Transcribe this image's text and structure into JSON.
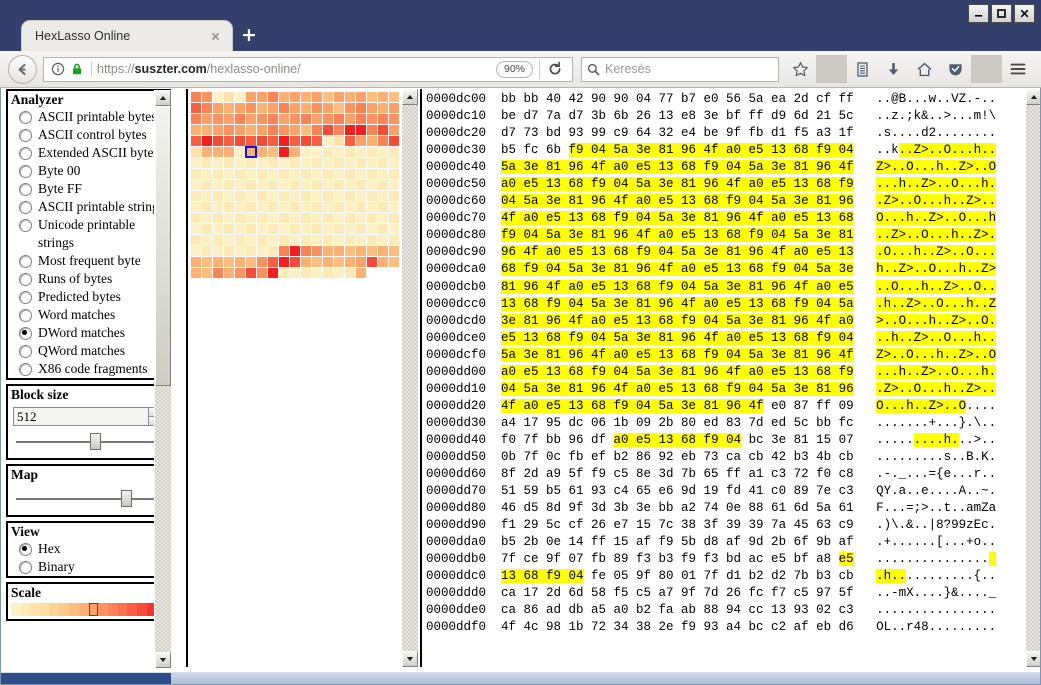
{
  "window": {
    "controls": [
      {
        "name": "minimize",
        "label": "–"
      },
      {
        "name": "maximize",
        "label": "□"
      },
      {
        "name": "close",
        "label": "✕"
      }
    ]
  },
  "browser": {
    "tab": {
      "title": "HexLasso Online",
      "close_label": "✕"
    },
    "new_tab_label": "+",
    "back_label": "←",
    "url": {
      "scheme": "https://",
      "host": "suszter.com",
      "path": "/hexlasso-online/",
      "full": "https://suszter.com/hexlasso-online/"
    },
    "zoom_level": "90%",
    "reload_label": "↻",
    "search_placeholder": "Keresés",
    "icons": {
      "info": "info-icon",
      "lock": "lock-icon",
      "search": "search-icon",
      "bookmark": "star-icon",
      "library": "library-icon",
      "downloads": "download-icon",
      "home": "home-icon",
      "shield": "shield-icon",
      "menu": "hamburger-menu-icon"
    }
  },
  "sidebar": {
    "analyzer": {
      "title": "Analyzer",
      "selected": "DWord matches",
      "options": [
        "ASCII printable bytes",
        "ASCII control bytes",
        "Extended ASCII bytes",
        "Byte 00",
        "Byte FF",
        "ASCII printable strings",
        "Unicode printable strings",
        "Most frequent byte",
        "Runs of bytes",
        "Predicted bytes",
        "Word matches",
        "DWord matches",
        "QWord matches",
        "X86 code fragments"
      ]
    },
    "block_size": {
      "title": "Block size",
      "value": "512",
      "slider_percent": 55
    },
    "map": {
      "title": "Map",
      "slider_percent": 78
    },
    "view": {
      "title": "View",
      "selected": "Hex",
      "options": [
        "Hex",
        "Binary"
      ]
    },
    "scale": {
      "title": "Scale",
      "selected_index": 8,
      "colors": [
        "#fdf0c4",
        "#fdeab6",
        "#fde3ab",
        "#fddca0",
        "#fdd395",
        "#fdc98a",
        "#fcbd7e",
        "#fcb074",
        "#fca269",
        "#fb9260",
        "#fb8257",
        "#fa704e",
        "#f95e43",
        "#f84a38",
        "#f6342c",
        "#f41e20"
      ]
    }
  },
  "heatmap": {
    "columns": 19,
    "selected_index": 100,
    "cells": [
      "#fb8257",
      "#fb9260",
      "#fdf0c4",
      "#fde3ab",
      "#fdf0c4",
      "#fca269",
      "#fca269",
      "#fb8257",
      "#fcb074",
      "#fca269",
      "#fcb074",
      "#fca269",
      "#fcbd7e",
      "#fca269",
      "#fcb074",
      "#fca269",
      "#fcbd7e",
      "#fcb074",
      "#fcbd7e",
      "#f95e43",
      "#fb8257",
      "#fca269",
      "#fcb074",
      "#fca269",
      "#fb9260",
      "#fcb074",
      "#fca269",
      "#fb8257",
      "#fca269",
      "#fcb074",
      "#fb9260",
      "#fca269",
      "#fcbd7e",
      "#fb9260",
      "#fb8257",
      "#fca269",
      "#fcb074",
      "#fca269",
      "#fb8257",
      "#fca269",
      "#fb9260",
      "#fca269",
      "#fb8257",
      "#fca269",
      "#fb9260",
      "#fb8257",
      "#fca269",
      "#fb9260",
      "#fb8257",
      "#fca269",
      "#fb9260",
      "#fb8257",
      "#fca269",
      "#fb8257",
      "#fb9260",
      "#fb8257",
      "#fb9260",
      "#fcb074",
      "#fcb074",
      "#fca269",
      "#fb9260",
      "#fca269",
      "#fcb074",
      "#fca269",
      "#fb8257",
      "#fb9260",
      "#fca269",
      "#fcbd7e",
      "#fb8257",
      "#f84a38",
      "#fb8257",
      "#f41e20",
      "#f41e20",
      "#fb8257",
      "#f84a38",
      "#fca269",
      "#f95e43",
      "#f41e20",
      "#f84a38",
      "#f95e43",
      "#f84a38",
      "#f95e43",
      "#f84a38",
      "#f95e43",
      "#f41e20",
      "#f95e43",
      "#f84a38",
      "#f95e43",
      "#fdf0c4",
      "#fde3ab",
      "#f95e43",
      "#fca269",
      "#fcb074",
      "#fb8257",
      "#f84a38",
      "#fde3ab",
      "#fcb074",
      "#fcb074",
      "#fcb074",
      "#fdf0c4",
      "#fcb074",
      "#fcb074",
      "#fcbd7e",
      "#f41e20",
      "#fcb074",
      "#fdf0c4",
      "#fdf0c4",
      "#fdeab6",
      "#fdf0c4",
      "#fdeab6",
      "#fdf0c4",
      "#fdeab6",
      "#fdf0c4",
      "#fdeab6",
      "#fdf0c4",
      "#fdeab6",
      "#fdf0c4",
      "#fdeab6",
      "#fdf0c4",
      "#fdeab6",
      "#fdf0c4",
      "#fdeab6",
      "#fdf0c4",
      "#fdeab6",
      "#fdf0c4",
      "#fdeab6",
      "#fdf0c4",
      "#fdeab6",
      "#fdf0c4",
      "#fdeab6",
      "#fdf0c4",
      "#fdeab6",
      "#fdf0c4",
      "#fdeab6",
      "#fdf0c4",
      "#fdeab6",
      "#fdf0c4",
      "#fdeab6",
      "#fdf0c4",
      "#fdeab6",
      "#fdf0c4",
      "#fdeab6",
      "#fdf0c4",
      "#fdeab6",
      "#fdf0c4",
      "#fdeab6",
      "#fdf0c4",
      "#fdeab6",
      "#fdf0c4",
      "#fdeab6",
      "#fdf0c4",
      "#fdeab6",
      "#fdf0c4",
      "#fdeab6",
      "#fdf0c4",
      "#fdeab6",
      "#fdf0c4",
      "#fdeab6",
      "#fdf0c4",
      "#fdeab6",
      "#fdf0c4",
      "#fdeab6",
      "#fdf0c4",
      "#fdeab6",
      "#fdf0c4",
      "#fdeab6",
      "#fdf0c4",
      "#fdeab6",
      "#fdf0c4",
      "#fdeab6",
      "#fdf0c4",
      "#fdeab6",
      "#fdf0c4",
      "#fdeab6",
      "#fdf0c4",
      "#fdeab6",
      "#fdf0c4",
      "#fdeab6",
      "#fdf0c4",
      "#fdeab6",
      "#fdf0c4",
      "#fdeab6",
      "#fdf0c4",
      "#fdeab6",
      "#fdf0c4",
      "#fdeab6",
      "#fdf0c4",
      "#fdeab6",
      "#fdf0c4",
      "#fdeab6",
      "#fdf0c4",
      "#fdeab6",
      "#fdf0c4",
      "#fdeab6",
      "#fdf0c4",
      "#fdeab6",
      "#fdf0c4",
      "#fdeab6",
      "#fdf0c4",
      "#fdeab6",
      "#fdf0c4",
      "#fdeab6",
      "#fdf0c4",
      "#fdeab6",
      "#fdf0c4",
      "#fdeab6",
      "#fdf0c4",
      "#fdeab6",
      "#fdf0c4",
      "#fdeab6",
      "#fdf0c4",
      "#fdeab6",
      "#fdf0c4",
      "#fdeab6",
      "#fdf0c4",
      "#fdeab6",
      "#fdf0c4",
      "#fdeab6",
      "#fdf0c4",
      "#fdeab6",
      "#fdf0c4",
      "#fdeab6",
      "#fdf0c4",
      "#fdeab6",
      "#fdf0c4",
      "#fdeab6",
      "#fdf0c4",
      "#fdeab6",
      "#fdf0c4",
      "#fdeab6",
      "#fdf0c4",
      "#fdeab6",
      "#fdf0c4",
      "#fdeab6",
      "#fdf0c4",
      "#fdeab6",
      "#fdf0c4",
      "#fdeab6",
      "#fdf0c4",
      "#fdeab6",
      "#fdf0c4",
      "#fdeab6",
      "#fdf0c4",
      "#fdeab6",
      "#fdf0c4",
      "#fdeab6",
      "#fdf0c4",
      "#fdeab6",
      "#fdf0c4",
      "#fdeab6",
      "#fdf0c4",
      "#fdeab6",
      "#fdf0c4",
      "#fdeab6",
      "#fdf0c4",
      "#fdeab6",
      "#fdf0c4",
      "#fdeab6",
      "#fdf0c4",
      "#fdeab6",
      "#fdf0c4",
      "#fdeab6",
      "#fdf0c4",
      "#fdeab6",
      "#fdf0c4",
      "#fdeab6",
      "#fdf0c4",
      "#fdeab6",
      "#fdf0c4",
      "#fdeab6",
      "#fdf0c4",
      "#fdeab6",
      "#fdf0c4",
      "#fdeab6",
      "#fb8257",
      "#f41e20",
      "#fb8257",
      "#fb9260",
      "#fcb074",
      "#fcb074",
      "#fcbd7e",
      "#fcb074",
      "#fcbd7e",
      "#fcb074",
      "#fcbd7e",
      "#fcb074",
      "#fcbd7e",
      "#fcb074",
      "#fcbd7e",
      "#fcb074",
      "#fcbd7e",
      "#fb9260",
      "#f95e43",
      "#f41e20",
      "#f84a38",
      "#fcb074",
      "#fcbd7e",
      "#fcb074",
      "#fcbd7e",
      "#fcb074",
      "#fca269",
      "#f84a38",
      "#fcb074",
      "#fcbd7e",
      "#fcb074",
      "#fcbd7e",
      "#fb8257",
      "#fcb074",
      "#fb9260",
      "#f84a38",
      "#fb9260",
      "#f41e20",
      "#fdeab6",
      "#fdf0c4",
      "#fdeab6",
      "#fdf0c4",
      "#fdeab6",
      "#fdf0c4",
      "#fdeab6",
      "#fcb074"
    ]
  },
  "hexview": {
    "rows": [
      {
        "offset": "0000dc00",
        "bytes": "bb bb 40 42 90 90 04 77 b7 e0 56 5a ea 2d cf ff",
        "ascii": "..@B...w..VZ.-..",
        "hl_start": null,
        "hl_end": null,
        "ascii_hl_start": null,
        "ascii_hl_end": null
      },
      {
        "offset": "0000dc10",
        "bytes": "be d7 7a d7 3b 6b 26 13 e8 3e bf ff d9 6d 21 5c",
        "ascii": "..z.;k&..>...m!\\",
        "hl_start": null,
        "hl_end": null,
        "ascii_hl_start": null,
        "ascii_hl_end": null
      },
      {
        "offset": "0000dc20",
        "bytes": "d7 73 bd 93 99 c9 64 32 e4 be 9f fb d1 f5 a3 1f",
        "ascii": ".s....d2........",
        "hl_start": null,
        "hl_end": null,
        "ascii_hl_start": null,
        "ascii_hl_end": null
      },
      {
        "offset": "0000dc30",
        "bytes": "b5 fc 6b f9 04 5a 3e 81 96 4f a0 e5 13 68 f9 04",
        "ascii": "..k..Z>..O...h..",
        "hl_start": 3,
        "hl_end": 16,
        "ascii_hl_start": 3,
        "ascii_hl_end": 16
      },
      {
        "offset": "0000dc40",
        "bytes": "5a 3e 81 96 4f a0 e5 13 68 f9 04 5a 3e 81 96 4f",
        "ascii": "Z>..O...h..Z>..O",
        "hl_start": 0,
        "hl_end": 16,
        "ascii_hl_start": 0,
        "ascii_hl_end": 16
      },
      {
        "offset": "0000dc50",
        "bytes": "a0 e5 13 68 f9 04 5a 3e 81 96 4f a0 e5 13 68 f9",
        "ascii": "...h..Z>..O...h.",
        "hl_start": 0,
        "hl_end": 16,
        "ascii_hl_start": 0,
        "ascii_hl_end": 16
      },
      {
        "offset": "0000dc60",
        "bytes": "04 5a 3e 81 96 4f a0 e5 13 68 f9 04 5a 3e 81 96",
        "ascii": ".Z>..O...h..Z>..",
        "hl_start": 0,
        "hl_end": 16,
        "ascii_hl_start": 0,
        "ascii_hl_end": 16
      },
      {
        "offset": "0000dc70",
        "bytes": "4f a0 e5 13 68 f9 04 5a 3e 81 96 4f a0 e5 13 68",
        "ascii": "O...h..Z>..O...h",
        "hl_start": 0,
        "hl_end": 16,
        "ascii_hl_start": 0,
        "ascii_hl_end": 16
      },
      {
        "offset": "0000dc80",
        "bytes": "f9 04 5a 3e 81 96 4f a0 e5 13 68 f9 04 5a 3e 81",
        "ascii": "..Z>..O...h..Z>.",
        "hl_start": 0,
        "hl_end": 16,
        "ascii_hl_start": 0,
        "ascii_hl_end": 16
      },
      {
        "offset": "0000dc90",
        "bytes": "96 4f a0 e5 13 68 f9 04 5a 3e 81 96 4f a0 e5 13",
        "ascii": ".O...h..Z>..O...",
        "hl_start": 0,
        "hl_end": 16,
        "ascii_hl_start": 0,
        "ascii_hl_end": 16
      },
      {
        "offset": "0000dca0",
        "bytes": "68 f9 04 5a 3e 81 96 4f a0 e5 13 68 f9 04 5a 3e",
        "ascii": "h..Z>..O...h..Z>",
        "hl_start": 0,
        "hl_end": 16,
        "ascii_hl_start": 0,
        "ascii_hl_end": 16
      },
      {
        "offset": "0000dcb0",
        "bytes": "81 96 4f a0 e5 13 68 f9 04 5a 3e 81 96 4f a0 e5",
        "ascii": "..O...h..Z>..O..",
        "hl_start": 0,
        "hl_end": 16,
        "ascii_hl_start": 0,
        "ascii_hl_end": 16
      },
      {
        "offset": "0000dcc0",
        "bytes": "13 68 f9 04 5a 3e 81 96 4f a0 e5 13 68 f9 04 5a",
        "ascii": ".h..Z>..O...h..Z",
        "hl_start": 0,
        "hl_end": 16,
        "ascii_hl_start": 0,
        "ascii_hl_end": 16
      },
      {
        "offset": "0000dcd0",
        "bytes": "3e 81 96 4f a0 e5 13 68 f9 04 5a 3e 81 96 4f a0",
        "ascii": ">..O...h..Z>..O.",
        "hl_start": 0,
        "hl_end": 16,
        "ascii_hl_start": 0,
        "ascii_hl_end": 16
      },
      {
        "offset": "0000dce0",
        "bytes": "e5 13 68 f9 04 5a 3e 81 96 4f a0 e5 13 68 f9 04",
        "ascii": "..h..Z>..O...h..",
        "hl_start": 0,
        "hl_end": 16,
        "ascii_hl_start": 0,
        "ascii_hl_end": 16
      },
      {
        "offset": "0000dcf0",
        "bytes": "5a 3e 81 96 4f a0 e5 13 68 f9 04 5a 3e 81 96 4f",
        "ascii": "Z>..O...h..Z>..O",
        "hl_start": 0,
        "hl_end": 16,
        "ascii_hl_start": 0,
        "ascii_hl_end": 16
      },
      {
        "offset": "0000dd00",
        "bytes": "a0 e5 13 68 f9 04 5a 3e 81 96 4f a0 e5 13 68 f9",
        "ascii": "...h..Z>..O...h.",
        "hl_start": 0,
        "hl_end": 16,
        "ascii_hl_start": 0,
        "ascii_hl_end": 16
      },
      {
        "offset": "0000dd10",
        "bytes": "04 5a 3e 81 96 4f a0 e5 13 68 f9 04 5a 3e 81 96",
        "ascii": ".Z>..O...h..Z>..",
        "hl_start": 0,
        "hl_end": 16,
        "ascii_hl_start": 0,
        "ascii_hl_end": 16
      },
      {
        "offset": "0000dd20",
        "bytes": "4f a0 e5 13 68 f9 04 5a 3e 81 96 4f e0 87 ff 09",
        "ascii": "O...h..Z>..O....",
        "hl_start": 0,
        "hl_end": 12,
        "ascii_hl_start": 0,
        "ascii_hl_end": 12
      },
      {
        "offset": "0000dd30",
        "bytes": "a4 17 95 dc 06 1b 09 2b 80 ed 83 7d ed 5c bb fc",
        "ascii": ".......+...}.\\..",
        "hl_start": null,
        "hl_end": null,
        "ascii_hl_start": null,
        "ascii_hl_end": null
      },
      {
        "offset": "0000dd40",
        "bytes": "f0 7f bb 96 df a0 e5 13 68 f9 04 bc 3e 81 15 07",
        "ascii": ".........h...>..",
        "hl_start": 5,
        "hl_end": 11,
        "ascii_hl_start": 5,
        "ascii_hl_end": 11
      },
      {
        "offset": "0000dd50",
        "bytes": "0b 7f 0c fb ef b2 86 92 eb 73 ca cb 42 b3 4b cb",
        "ascii": ".........s..B.K.",
        "hl_start": null,
        "hl_end": null,
        "ascii_hl_start": null,
        "ascii_hl_end": null
      },
      {
        "offset": "0000dd60",
        "bytes": "8f 2d a9 5f f9 c5 8e 3d 7b 65 ff a1 c3 72 f0 c8",
        "ascii": ".-._...={e...r..",
        "hl_start": null,
        "hl_end": null,
        "ascii_hl_start": null,
        "ascii_hl_end": null
      },
      {
        "offset": "0000dd70",
        "bytes": "51 59 b5 61 93 c4 65 e6 9d 19 fd 41 c0 89 7e c3",
        "ascii": "QY.a..e....A..~.",
        "hl_start": null,
        "hl_end": null,
        "ascii_hl_start": null,
        "ascii_hl_end": null
      },
      {
        "offset": "0000dd80",
        "bytes": "46 d5 8d 9f 3d 3b 3e bb a2 74 0e 88 61 6d 5a 61",
        "ascii": "F...=;>..t..amZa",
        "hl_start": null,
        "hl_end": null,
        "ascii_hl_start": null,
        "ascii_hl_end": null
      },
      {
        "offset": "0000dd90",
        "bytes": "f1 29 5c cf 26 e7 15 7c 38 3f 39 39 7a 45 63 c9",
        "ascii": ".)\\.&..|8?99zEc.",
        "hl_start": null,
        "hl_end": null,
        "ascii_hl_start": null,
        "ascii_hl_end": null
      },
      {
        "offset": "0000dda0",
        "bytes": "b5 2b 0e 14 ff 15 af f9 5b d8 af 9d 2b 6f 9b af",
        "ascii": ".+......[...+o..",
        "hl_start": null,
        "hl_end": null,
        "ascii_hl_start": null,
        "ascii_hl_end": null
      },
      {
        "offset": "0000ddb0",
        "bytes": "7f ce 9f 07 fb 89 f3 b3 f9 f3 bd ac e5 bf a8 e5",
        "ascii": "...............",
        "hl_start": 15,
        "hl_end": 16,
        "ascii_hl_start": 15,
        "ascii_hl_end": 16
      },
      {
        "offset": "0000ddc0",
        "bytes": "13 68 f9 04 fe 05 9f 80 01 7f d1 b2 d2 7b b3 cb",
        "ascii": ".h...........{..",
        "hl_start": 0,
        "hl_end": 4,
        "ascii_hl_start": 0,
        "ascii_hl_end": 4
      },
      {
        "offset": "0000ddd0",
        "bytes": "ca 17 2d 6d 58 f5 c5 a7 9f 7d 26 fc f7 c5 97 5f",
        "ascii": "..-mX....}&...._",
        "hl_start": null,
        "hl_end": null,
        "ascii_hl_start": null,
        "ascii_hl_end": null
      },
      {
        "offset": "0000dde0",
        "bytes": "ca 86 ad db a5 a0 b2 fa ab 88 94 cc 13 93 02 c3",
        "ascii": "................",
        "hl_start": null,
        "hl_end": null,
        "ascii_hl_start": null,
        "ascii_hl_end": null
      },
      {
        "offset": "0000ddf0",
        "bytes": "4f 4c 98 1b 72 34 38 2e f9 93 a4 bc c2 af eb d6",
        "ascii": "OL..r48.........",
        "hl_start": null,
        "hl_end": null,
        "ascii_hl_start": null,
        "ascii_hl_end": null
      }
    ]
  }
}
